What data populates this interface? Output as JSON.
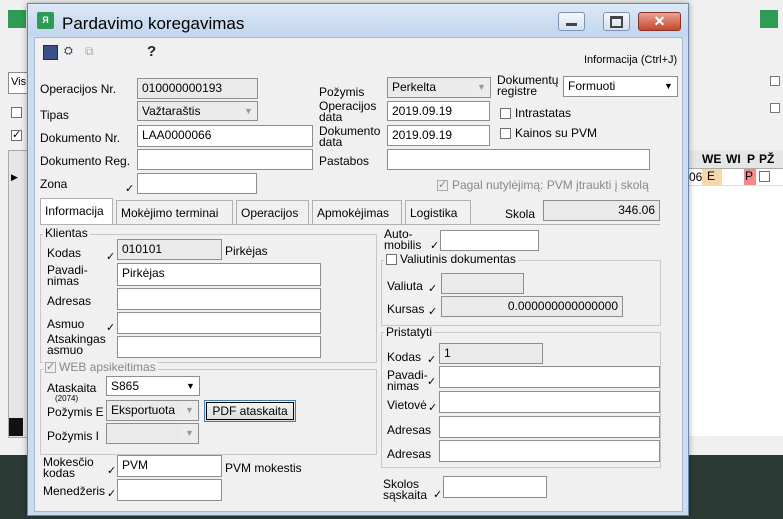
{
  "window": {
    "title": "Pardavimo koregavimas"
  },
  "toolbar": {
    "help_icon": "?",
    "info_link": "Informacija (Ctrl+J)"
  },
  "background": {
    "field_text": "Vis",
    "grid_headers": [
      "WE",
      "WI",
      "P",
      "PŽ"
    ],
    "row_values": [
      "06",
      "E",
      "P"
    ]
  },
  "form": {
    "operacijos_nr": {
      "label": "Operacijos Nr.",
      "value": "010000000193"
    },
    "tipas": {
      "label": "Tipas",
      "value": "Važtaraštis"
    },
    "dokumento_nr": {
      "label": "Dokumento Nr.",
      "value": "LAA0000066"
    },
    "dokumento_reg": {
      "label": "Dokumento Reg.",
      "value": ""
    },
    "zona": {
      "label": "Zona",
      "value": ""
    },
    "pozymis": {
      "label": "Požymis",
      "value": "Perkelta"
    },
    "operacijos_data": {
      "label": "Operacijos data",
      "value": "2019.09.19"
    },
    "dokumento_data": {
      "label": "Dokumento data",
      "value": "2019.09.19"
    },
    "pastabos": {
      "label": "Pastabos",
      "value": ""
    },
    "dokumentu_registre": {
      "label": "Dokumentų registre",
      "value": "Formuoti"
    },
    "intrastatas": {
      "label": "Intrastatas",
      "checked": false
    },
    "kainos_su_pvm": {
      "label": "Kainos su PVM",
      "checked": false
    },
    "pagal_nutylejima": {
      "label": "Pagal nutylėjimą: PVM įtraukti į skolą",
      "checked": true
    }
  },
  "tabs": [
    {
      "label": "Informacija",
      "active": true
    },
    {
      "label": "Mokėjimo terminai"
    },
    {
      "label": "Operacijos"
    },
    {
      "label": "Apmokėjimas"
    },
    {
      "label": "Logistika"
    }
  ],
  "skola": {
    "label": "Skola",
    "value": "346.06"
  },
  "klientas": {
    "title": "Klientas",
    "kodas": {
      "label": "Kodas",
      "value": "010101",
      "name": "Pirkėjas"
    },
    "pavadinimas": {
      "label": "Pavadi-nimas",
      "value": "Pirkėjas"
    },
    "adresas": {
      "label": "Adresas",
      "value": ""
    },
    "asmuo": {
      "label": "Asmuo",
      "value": ""
    },
    "atsakingas": {
      "label": "Atsakingas asmuo",
      "value": ""
    }
  },
  "web": {
    "title": "WEB apsikeitimas",
    "ataskaita": {
      "label": "Ataskaita",
      "sub": "(2074)",
      "value": "S865"
    },
    "pozymis_e": {
      "label": "Požymis E",
      "value": "Eksportuota"
    },
    "pdf_button": "PDF ataskaita",
    "pozymis_i": {
      "label": "Požymis I",
      "value": ""
    }
  },
  "mokestis": {
    "label": "Mokesčio kodas",
    "value": "PVM",
    "desc": "PVM mokestis"
  },
  "menedzeris": {
    "label": "Menedžeris",
    "value": ""
  },
  "automobilis": {
    "label": "Auto-mobilis",
    "value": ""
  },
  "valiutinis": {
    "title": "Valiutinis dokumentas",
    "valiuta": {
      "label": "Valiuta",
      "value": ""
    },
    "kursas": {
      "label": "Kursas",
      "value": "0.000000000000000"
    }
  },
  "pristatyti": {
    "title": "Pristatyti",
    "kodas": {
      "label": "Kodas",
      "value": "1"
    },
    "pavadinimas": {
      "label": "Pavadi-nimas",
      "value": ""
    },
    "vietove": {
      "label": "Vietovė",
      "value": ""
    },
    "adresas1": {
      "label": "Adresas",
      "value": ""
    },
    "adresas2": {
      "label": "Adresas",
      "value": ""
    }
  },
  "skolos_saskaita": {
    "label": "Skolos sąskaita",
    "value": ""
  },
  "colors": {
    "accent_orange": "#f6d7a7",
    "accent_red": "#f58a8a",
    "title_bg": "#c9dcf2"
  }
}
